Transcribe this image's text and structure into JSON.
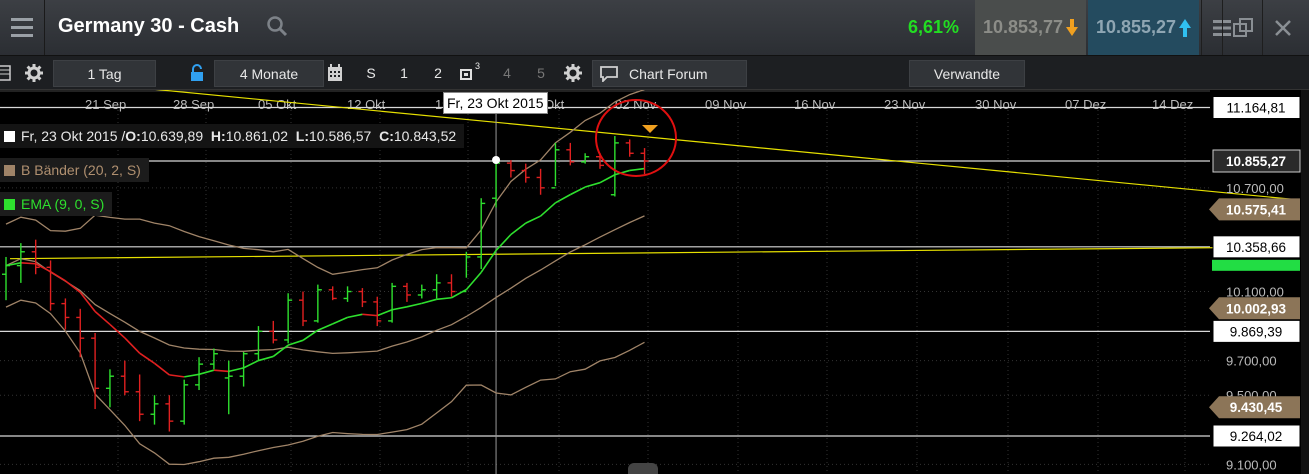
{
  "header": {
    "title": "Germany 30 - Cash",
    "change_pct": "6,61%",
    "bid": "10.853,77",
    "ask": "10.855,27"
  },
  "toolbar": {
    "interval": "1 Tag",
    "range": "4 Monate",
    "btn_s": "S",
    "btn_1": "1",
    "btn_2": "2",
    "btn_3": "3",
    "btn_4": "4",
    "btn_5": "5",
    "chart_forum": "Chart Forum",
    "verwandte": "Verwandte"
  },
  "legend": {
    "ohlc_date": "Fr, 23 Okt 2015 / ",
    "o_label": "O:",
    "o_value": "10.639,89",
    "h_label": "H:",
    "h_value": "10.861,02",
    "l_label": "L:",
    "l_value": "10.586,57",
    "c_label": "C:",
    "c_value": "10.843,52",
    "bb": "B Bänder (20, 2, S)",
    "ema": "EMA (9, 0, S)"
  },
  "crosshair_date": "Fr, 23 Okt 2015",
  "colors": {
    "up": "#2ee02e",
    "down": "#e02020",
    "ema": "#2ee02e",
    "ema_down": "#e02020",
    "bollinger": "#a08468",
    "trendline": "#e6e000",
    "annotation": "#e01010",
    "ask_arrow": "#30c0f0",
    "bid_arrow": "#f0a020"
  },
  "chart_data": {
    "type": "ohlc",
    "x_labels": [
      "21 Sep",
      "28 Sep",
      "05 Okt",
      "12 Okt",
      "19 Okt",
      "26 Okt",
      "02 Nov",
      "09 Nov",
      "16 Nov",
      "23 Nov",
      "30 Nov",
      "07 Dez",
      "14 Dez"
    ],
    "y_ticks": [
      "10.700,00",
      "10.100,00",
      "9.700,00",
      "9.500,00",
      "9.100,00"
    ],
    "price_tags": [
      {
        "value": 11164.81,
        "text": "11.164,81",
        "style": "white"
      },
      {
        "value": 10855.27,
        "text": "10.855,27",
        "style": "dark"
      },
      {
        "value": 10575.41,
        "text": "10.575,41",
        "style": "brown"
      },
      {
        "value": 10358.66,
        "text": "10.358,66",
        "style": "white"
      },
      {
        "value": 10002.93,
        "text": "10.002,93",
        "style": "brown"
      },
      {
        "value": 9869.39,
        "text": "9.869,39",
        "style": "white"
      },
      {
        "value": 9430.45,
        "text": "9.430,45",
        "style": "brown"
      },
      {
        "value": 9264.02,
        "text": "9.264,02",
        "style": "white"
      }
    ],
    "bars": [
      {
        "o": 10200,
        "h": 10300,
        "l": 10050,
        "c": 10250
      },
      {
        "o": 10250,
        "h": 10380,
        "l": 10150,
        "c": 10330
      },
      {
        "o": 10330,
        "h": 10400,
        "l": 10200,
        "c": 10240
      },
      {
        "o": 10240,
        "h": 10280,
        "l": 9990,
        "c": 10030
      },
      {
        "o": 10030,
        "h": 10060,
        "l": 9880,
        "c": 9950
      },
      {
        "o": 9950,
        "h": 10000,
        "l": 9720,
        "c": 9830
      },
      {
        "o": 9830,
        "h": 9860,
        "l": 9420,
        "c": 9540
      },
      {
        "o": 9540,
        "h": 9650,
        "l": 9430,
        "c": 9610
      },
      {
        "o": 9610,
        "h": 9700,
        "l": 9500,
        "c": 9520
      },
      {
        "o": 9520,
        "h": 9620,
        "l": 9350,
        "c": 9390
      },
      {
        "o": 9390,
        "h": 9500,
        "l": 9330,
        "c": 9450
      },
      {
        "o": 9450,
        "h": 9500,
        "l": 9290,
        "c": 9350
      },
      {
        "o": 9350,
        "h": 9590,
        "l": 9330,
        "c": 9560
      },
      {
        "o": 9560,
        "h": 9720,
        "l": 9530,
        "c": 9680
      },
      {
        "o": 9680,
        "h": 9770,
        "l": 9650,
        "c": 9740
      },
      {
        "o": 9600,
        "h": 9700,
        "l": 9390,
        "c": 9610
      },
      {
        "o": 9610,
        "h": 9750,
        "l": 9550,
        "c": 9740
      },
      {
        "o": 9740,
        "h": 9900,
        "l": 9700,
        "c": 9870
      },
      {
        "o": 9870,
        "h": 9930,
        "l": 9800,
        "c": 9820
      },
      {
        "o": 9820,
        "h": 10090,
        "l": 9800,
        "c": 10050
      },
      {
        "o": 10050,
        "h": 10100,
        "l": 9900,
        "c": 9930
      },
      {
        "o": 9930,
        "h": 10140,
        "l": 9920,
        "c": 10110
      },
      {
        "o": 10110,
        "h": 10130,
        "l": 10050,
        "c": 10060
      },
      {
        "o": 10060,
        "h": 10130,
        "l": 10040,
        "c": 10100
      },
      {
        "o": 10100,
        "h": 10120,
        "l": 10010,
        "c": 10040
      },
      {
        "o": 10040,
        "h": 10070,
        "l": 9900,
        "c": 9930
      },
      {
        "o": 9930,
        "h": 10150,
        "l": 9920,
        "c": 10130
      },
      {
        "o": 10130,
        "h": 10150,
        "l": 10040,
        "c": 10080
      },
      {
        "o": 10080,
        "h": 10140,
        "l": 10060,
        "c": 10110
      },
      {
        "o": 10110,
        "h": 10200,
        "l": 10060,
        "c": 10150
      },
      {
        "o": 10150,
        "h": 10200,
        "l": 10070,
        "c": 10100
      },
      {
        "o": 10100,
        "h": 10330,
        "l": 10180,
        "c": 10300
      },
      {
        "o": 10300,
        "h": 10640,
        "l": 10230,
        "c": 10610
      },
      {
        "o": 10639.89,
        "h": 10861.02,
        "l": 10586.57,
        "c": 10843.52
      },
      {
        "o": 10843,
        "h": 10860,
        "l": 10760,
        "c": 10800
      },
      {
        "o": 10800,
        "h": 10840,
        "l": 10730,
        "c": 10760
      },
      {
        "o": 10760,
        "h": 10810,
        "l": 10660,
        "c": 10700
      },
      {
        "o": 10700,
        "h": 10960,
        "l": 10710,
        "c": 10920
      },
      {
        "o": 10920,
        "h": 10960,
        "l": 10830,
        "c": 10850
      },
      {
        "o": 10850,
        "h": 10900,
        "l": 10840,
        "c": 10880
      },
      {
        "o": 10880,
        "h": 10900,
        "l": 10810,
        "c": 10830
      },
      {
        "o": 10660,
        "h": 11000,
        "l": 10650,
        "c": 10960
      },
      {
        "o": 10960,
        "h": 10980,
        "l": 10880,
        "c": 10900
      },
      {
        "o": 10900,
        "h": 10930,
        "l": 10780,
        "c": 10855
      }
    ]
  }
}
